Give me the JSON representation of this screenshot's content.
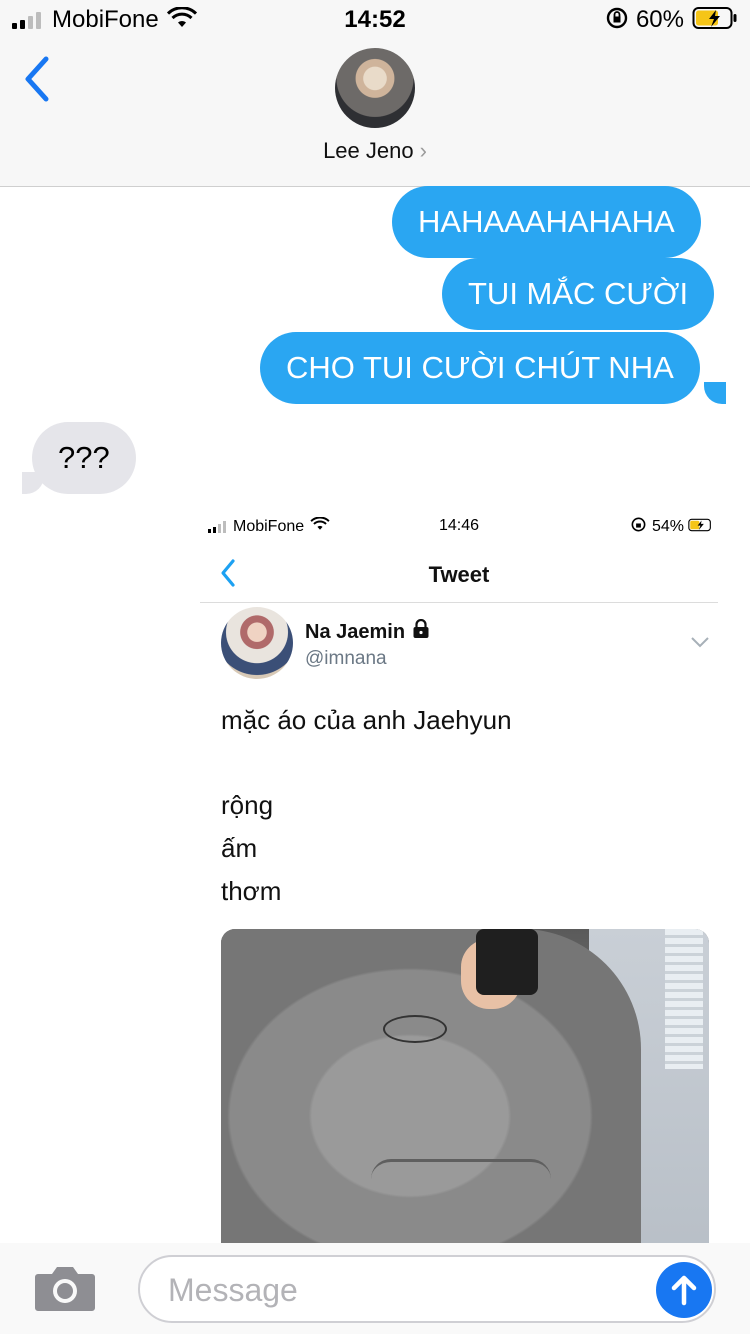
{
  "status_bar": {
    "carrier": "MobiFone",
    "time": "14:52",
    "battery": "60%"
  },
  "header": {
    "contact_name": "Lee Jeno",
    "chevron": "›"
  },
  "messages": [
    {
      "side": "sent",
      "text": "HAHAAAHAHAHA"
    },
    {
      "side": "sent",
      "text": "TUI MẮC CƯỜI"
    },
    {
      "side": "sent",
      "text": "CHO TUI CƯỜI CHÚT NHA"
    },
    {
      "side": "received",
      "text": "???"
    }
  ],
  "attachment": {
    "status_bar": {
      "carrier": "MobiFone",
      "time": "14:46",
      "battery": "54%"
    },
    "nav_title": "Tweet",
    "author_name": "Na Jaemin",
    "author_handle": "@imnana",
    "text_lines": [
      "mặc áo của anh Jaehyun",
      "rộng",
      "ấm",
      "thơm"
    ],
    "locked": true
  },
  "composer": {
    "placeholder": "Message"
  },
  "colors": {
    "sent_bubble": "#2aa6f2",
    "received_bubble": "#e5e5ea",
    "accent": "#1877f2"
  },
  "icons": [
    "back-chevron-icon",
    "camera-icon",
    "send-arrow-icon",
    "wifi-icon",
    "battery-icon",
    "lock-icon"
  ]
}
